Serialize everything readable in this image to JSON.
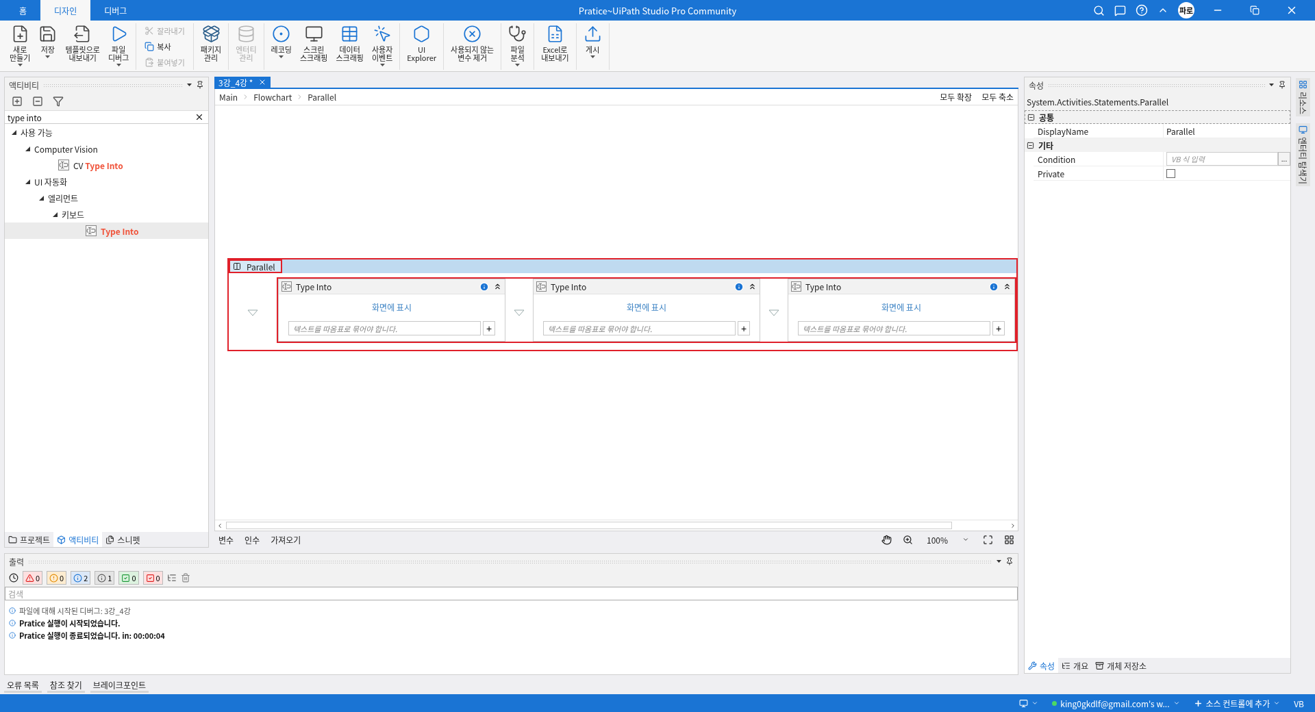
{
  "window": {
    "title": "Pratice~UiPath Studio Pro Community",
    "avatar": "파로"
  },
  "menu_tabs": [
    {
      "label": "홈",
      "selected": false
    },
    {
      "label": "디자인",
      "selected": true
    },
    {
      "label": "디버그",
      "selected": false
    }
  ],
  "ribbon": {
    "groups": [
      {
        "items": [
          {
            "kind": "large",
            "label": "새로\n만들기",
            "dropdown": true,
            "disabled": false
          },
          {
            "kind": "large",
            "label": "저장",
            "dropdown": true,
            "disabled": false
          },
          {
            "kind": "large",
            "label": "템플릿으로\n내보내기",
            "dropdown": false,
            "disabled": false
          },
          {
            "kind": "large",
            "label": "파일\n디버그",
            "dropdown": true,
            "disabled": false
          }
        ]
      },
      {
        "items": [
          {
            "kind": "small",
            "label": "잘라내기",
            "disabled": true
          },
          {
            "kind": "small",
            "label": "복사",
            "disabled": false
          },
          {
            "kind": "small",
            "label": "붙여넣기",
            "disabled": true
          }
        ]
      },
      {
        "items": [
          {
            "kind": "large",
            "label": "패키지\n관리",
            "dropdown": false,
            "disabled": false
          }
        ]
      },
      {
        "items": [
          {
            "kind": "large",
            "label": "엔터티\n관리",
            "dropdown": false,
            "disabled": true
          }
        ]
      },
      {
        "items": [
          {
            "kind": "large",
            "label": "레코딩",
            "dropdown": true,
            "disabled": false
          },
          {
            "kind": "large",
            "label": "스크린\n스크래핑",
            "dropdown": false,
            "disabled": false
          },
          {
            "kind": "large",
            "label": "데이터\n스크래핑",
            "dropdown": false,
            "disabled": false
          },
          {
            "kind": "large",
            "label": "사용자\n이벤트",
            "dropdown": true,
            "disabled": false
          }
        ]
      },
      {
        "items": [
          {
            "kind": "large",
            "label": "UI\nExplorer",
            "dropdown": false,
            "disabled": false
          }
        ]
      },
      {
        "items": [
          {
            "kind": "large",
            "label": "사용되지 않는\n변수 제거",
            "dropdown": false,
            "disabled": false
          }
        ]
      },
      {
        "items": [
          {
            "kind": "large",
            "label": "파일\n분석",
            "dropdown": true,
            "disabled": false
          }
        ]
      },
      {
        "items": [
          {
            "kind": "large",
            "label": "Excel로\n내보내기",
            "dropdown": false,
            "disabled": false
          }
        ]
      },
      {
        "items": [
          {
            "kind": "large",
            "label": "게시",
            "dropdown": true,
            "disabled": false
          }
        ]
      }
    ]
  },
  "activities_panel": {
    "title": "액티비티",
    "search": {
      "value": "type into"
    },
    "tree": [
      {
        "label": "사용 가능",
        "expanded": true,
        "selected": false,
        "children": [
          {
            "label": "Computer Vision",
            "expanded": true,
            "selected": false,
            "children": [
              {
                "prefix": "CV",
                "match": "Type Into",
                "selected": false
              }
            ]
          },
          {
            "label": "UI 자동화",
            "expanded": true,
            "selected": false,
            "children": [
              {
                "label": "엘리먼트",
                "expanded": true,
                "selected": false,
                "children": [
                  {
                    "label": "키보드",
                    "expanded": true,
                    "selected": false,
                    "children": [
                      {
                        "match": "Type Into",
                        "selected": true
                      }
                    ]
                  }
                ]
              }
            ]
          }
        ]
      }
    ],
    "tabs": [
      {
        "label": "프로젝트",
        "selected": false
      },
      {
        "label": "액티비티",
        "selected": true
      },
      {
        "label": "스니펫",
        "selected": false
      }
    ]
  },
  "designer": {
    "document_tab": {
      "label": "3강_4강 *",
      "selected": true
    },
    "breadcrumb": [
      "Main",
      "Flowchart",
      "Parallel"
    ],
    "actions": [
      "모두 확장",
      "모두 축소"
    ],
    "parallel": {
      "title": "Parallel",
      "branches": [
        {
          "title": "Type Into",
          "link": "화면에 표시",
          "placeholder": "텍스트를 따옴표로 묶어야 합니다.",
          "add_button": "+"
        },
        {
          "title": "Type Into",
          "link": "화면에 표시",
          "placeholder": "텍스트를 따옴표로 묶어야 합니다.",
          "add_button": "+"
        },
        {
          "title": "Type Into",
          "link": "화면에 표시",
          "placeholder": "텍스트를 따옴표로 묶어야 합니다.",
          "add_button": "+"
        }
      ]
    },
    "bottom_tabs": [
      "변수",
      "인수",
      "가져오기"
    ],
    "zoom": "100%"
  },
  "properties_panel": {
    "title": "속성",
    "type_name": "System.Activities.Statements.Parallel",
    "categories": [
      {
        "name": "공통",
        "expanded": true,
        "properties": [
          {
            "kind": "text",
            "name": "DisplayName",
            "value": "Parallel"
          }
        ]
      },
      {
        "name": "기타",
        "expanded": true,
        "properties": [
          {
            "kind": "expression",
            "name": "Condition",
            "placeholder": "VB 식 입력",
            "button": "..."
          },
          {
            "kind": "checkbox",
            "name": "Private",
            "checked": false
          }
        ]
      }
    ],
    "tabs": [
      {
        "label": "속성",
        "selected": true
      },
      {
        "label": "개요",
        "selected": false
      },
      {
        "label": "개체 저장소",
        "selected": false
      }
    ]
  },
  "side_strip": [
    "리소스",
    "엔터티 탐색기"
  ],
  "output_panel": {
    "title": "출력",
    "counters": [
      {
        "kind": "error",
        "count": "0"
      },
      {
        "kind": "warning",
        "count": "0"
      },
      {
        "kind": "info",
        "count": "2"
      },
      {
        "kind": "trace",
        "count": "1"
      },
      {
        "kind": "success",
        "count": "0"
      },
      {
        "kind": "failure",
        "count": "0"
      }
    ],
    "search": {
      "placeholder": "검색"
    },
    "lines": [
      {
        "kind": "debug",
        "text": "파일에 대해 시작된 디버그: 3강_4강"
      },
      {
        "kind": "info",
        "text": "Pratice 실행이 시작되었습니다."
      },
      {
        "kind": "info",
        "text": "Pratice 실행이 종료되었습니다. in: 00:00:04"
      }
    ]
  },
  "bottom_tabs": [
    "오류 목록",
    "참조 찾기",
    "브레이크포인트"
  ],
  "status_bar": {
    "account": "king0gkdlf@gmail.com's w...",
    "source_control": "소스 컨트롤에 추가",
    "language": "VB"
  }
}
